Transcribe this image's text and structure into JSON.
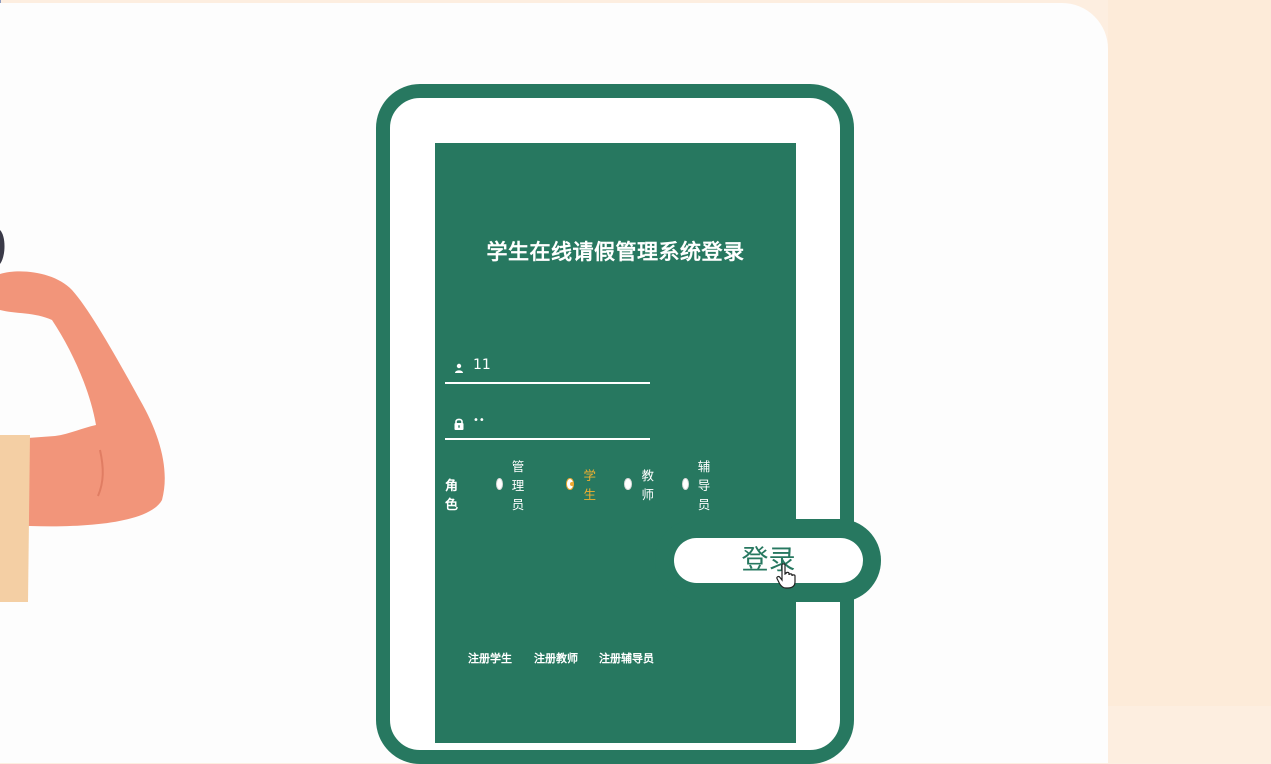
{
  "colors": {
    "brand_green": "#277860",
    "accent_orange": "#f0b030",
    "background_peach": "#fdeee0",
    "skin": "#f2957a"
  },
  "login": {
    "title": "学生在线请假管理系统登录",
    "username": {
      "icon": "user-icon",
      "value": "11"
    },
    "password": {
      "icon": "lock-icon",
      "value": "••"
    },
    "role": {
      "label": "角色",
      "options": [
        {
          "label": "管理员",
          "checked": false
        },
        {
          "label": "学生",
          "checked": true
        },
        {
          "label": "教师",
          "checked": false
        },
        {
          "label": "辅导员",
          "checked": false
        }
      ]
    },
    "submit_label": "登录"
  },
  "register_links": [
    "注册学生",
    "注册教师",
    "注册辅导员"
  ]
}
